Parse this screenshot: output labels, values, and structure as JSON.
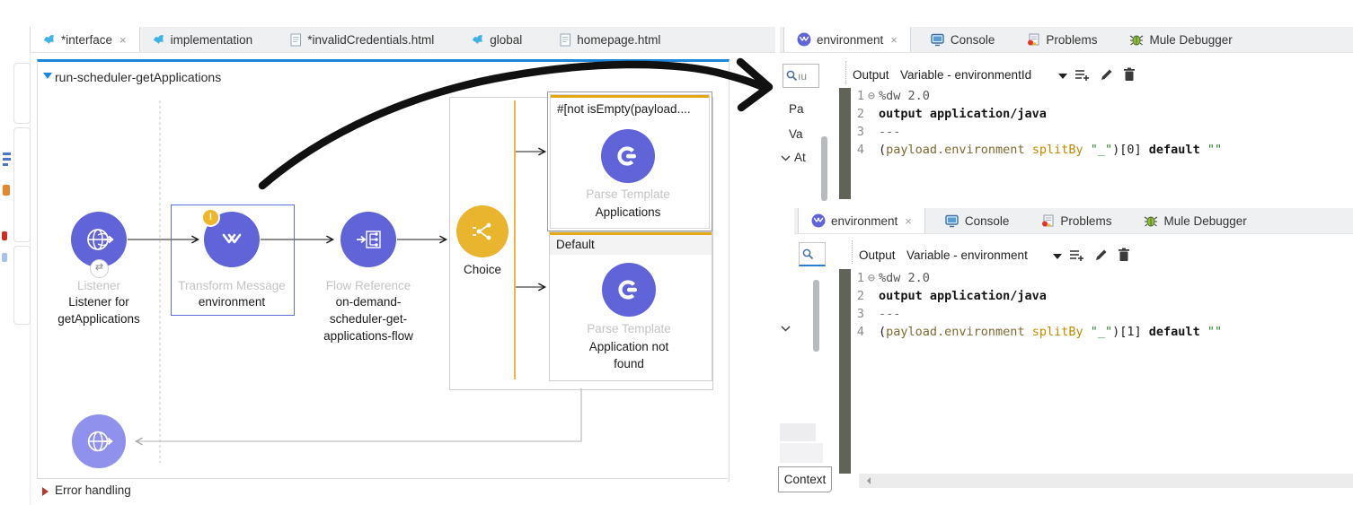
{
  "colors": {
    "component_purple": "#6163d8",
    "response_purple": "#8f91ec",
    "choice_yellow": "#e9b42e",
    "branch_yellow": "#e2a914",
    "selection_blue": "#5c6cdb",
    "flow_title_blue": "#1e87da",
    "gutter_bar_olive": "#5f6358",
    "warning_badge_yellow": "#eeb62b",
    "annotation_arrow_black": "#111111"
  },
  "editor": {
    "tabs": [
      {
        "label": "*interface",
        "icon": "mule-flow-icon",
        "close": "×"
      },
      {
        "label": "implementation",
        "icon": "mule-flow-icon"
      },
      {
        "label": "*invalidCredentials.html",
        "icon": "html-file-icon"
      },
      {
        "label": "global",
        "icon": "mule-flow-icon"
      },
      {
        "label": "homepage.html",
        "icon": "html-file-icon"
      }
    ],
    "flow": {
      "title": "run-scheduler-getApplications",
      "listener": {
        "type": "Listener",
        "name": "Listener for getApplications",
        "badge": "⇄"
      },
      "transform": {
        "type": "Transform Message",
        "name": "environment",
        "warning": "!"
      },
      "flow_reference": {
        "type": "Flow Reference",
        "name": "on-demand-scheduler-get-applications-flow"
      },
      "choice": {
        "label": "Choice"
      },
      "when_route": {
        "condition": "#[not isEmpty(payload....",
        "parse_type": "Parse Template",
        "parse_name": "Applications"
      },
      "default_route": {
        "header": "Default",
        "parse_type": "Parse Template",
        "parse_name": "Application not found"
      },
      "error_handling": "Error handling"
    }
  },
  "debugger_top": {
    "tabs": [
      {
        "label": "environment",
        "icon": "dataweave-icon",
        "close": "×"
      },
      {
        "label": "Console",
        "icon": "console-icon"
      },
      {
        "label": "Problems",
        "icon": "problems-icon"
      },
      {
        "label": "Mule Debugger",
        "icon": "bug-icon"
      }
    ],
    "search_text": "ıu",
    "toolbar": {
      "output_label": "Output",
      "variable_label": "Variable - environmentId"
    },
    "sidebar": [
      "Pa",
      "Va",
      "At"
    ],
    "code": [
      {
        "num": "1",
        "fold": "⊖",
        "tokens": [
          [
            "hdr",
            "%dw 2.0"
          ]
        ]
      },
      {
        "num": "2",
        "fold": "",
        "tokens": [
          [
            "kw",
            "output application/java"
          ]
        ]
      },
      {
        "num": "3",
        "fold": "",
        "tokens": [
          [
            "sep",
            "---"
          ]
        ]
      },
      {
        "num": "4",
        "fold": "",
        "tokens": [
          [
            "pln",
            "("
          ],
          [
            "var",
            "payload.environment"
          ],
          [
            "pln",
            " "
          ],
          [
            "fn",
            "splitBy"
          ],
          [
            "pln",
            " "
          ],
          [
            "str",
            "\"_\""
          ],
          [
            "pln",
            ")[0] "
          ],
          [
            "kw",
            "default"
          ],
          [
            "pln",
            " "
          ],
          [
            "str",
            "\"\""
          ]
        ]
      }
    ]
  },
  "debugger_bottom": {
    "tabs": [
      {
        "label": "environment",
        "icon": "dataweave-icon",
        "close": "×"
      },
      {
        "label": "Console",
        "icon": "console-icon"
      },
      {
        "label": "Problems",
        "icon": "problems-icon"
      },
      {
        "label": "Mule Debugger",
        "icon": "bug-icon"
      }
    ],
    "toolbar": {
      "output_label": "Output",
      "variable_label": "Variable - environment"
    },
    "context_tab": "Context",
    "code": [
      {
        "num": "1",
        "fold": "⊖",
        "tokens": [
          [
            "hdr",
            "%dw 2.0"
          ]
        ]
      },
      {
        "num": "2",
        "fold": "",
        "tokens": [
          [
            "kw",
            "output application/java"
          ]
        ]
      },
      {
        "num": "3",
        "fold": "",
        "tokens": [
          [
            "sep",
            "---"
          ]
        ]
      },
      {
        "num": "4",
        "fold": "",
        "tokens": [
          [
            "pln",
            "("
          ],
          [
            "var",
            "payload.environment"
          ],
          [
            "pln",
            " "
          ],
          [
            "fn",
            "splitBy"
          ],
          [
            "pln",
            " "
          ],
          [
            "str",
            "\"_\""
          ],
          [
            "pln",
            ")[1] "
          ],
          [
            "kw",
            "default"
          ],
          [
            "pln",
            " "
          ],
          [
            "str",
            "\"\""
          ]
        ]
      }
    ]
  }
}
